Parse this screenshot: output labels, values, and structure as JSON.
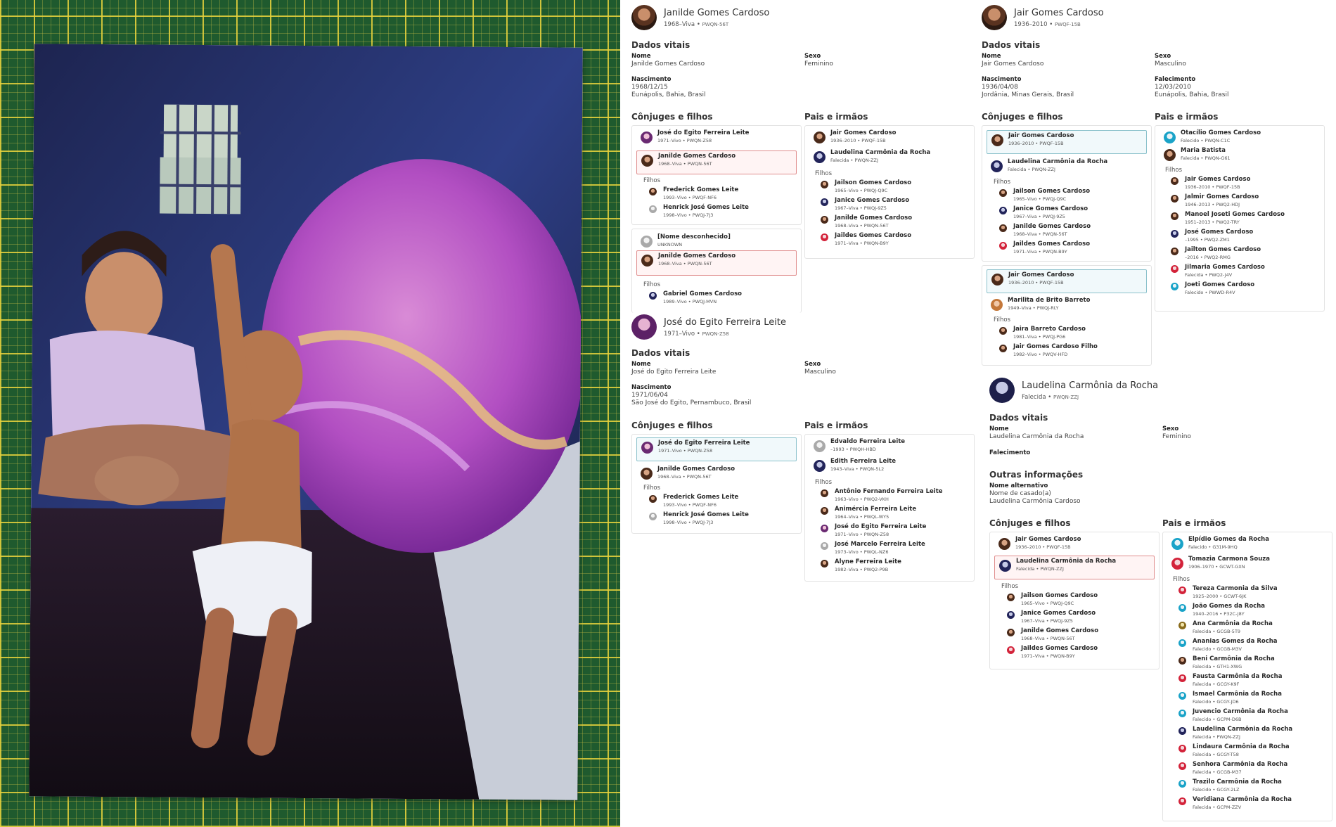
{
  "profiles": {
    "janilde": {
      "name": "Janilde Gomes Cardoso",
      "meta": "1968–Viva",
      "pid": "PWQN-56T",
      "vitals_title": "Dados vitais",
      "nome_label": "Nome",
      "nome_value": "Janilde Gomes Cardoso",
      "sexo_label": "Sexo",
      "sexo_value": "Feminino",
      "nasc_label": "Nascimento",
      "nasc_date": "1968/12/15",
      "nasc_place": "Eunápolis, Bahia, Brasil",
      "spouses_title": "Cônjuges e filhos",
      "parents_title": "Pais e irmãos",
      "family1": [
        {
          "name": "José do Egito Ferreira Leite",
          "meta": "1971–Vivo • PWQN-Z58"
        },
        {
          "name": "Janilde Gomes Cardoso",
          "meta": "1968–Viva • PWQN-56T"
        }
      ],
      "family1_filhos": "Filhos",
      "family1_children": [
        {
          "name": "Frederick Gomes Leite",
          "meta": "1993–Vivo • PWQF-NF6"
        },
        {
          "name": "Henrick José Gomes Leite",
          "meta": "1998–Vivo • PWQJ-7J3"
        }
      ],
      "family2": [
        {
          "name": "[Nome desconhecido]",
          "meta": "UNKNOWN"
        },
        {
          "name": "Janilde Gomes Cardoso",
          "meta": "1968–Viva • PWQN-56T"
        }
      ],
      "family2_filhos": "Filhos",
      "family2_children": [
        {
          "name": "Gabriel Gomes Cardoso",
          "meta": "1989–Vivo • PWQJ-MVN"
        }
      ],
      "parents": [
        {
          "name": "Jair Gomes Cardoso",
          "meta": "1936–2010 • PWQF-15B"
        },
        {
          "name": "Laudelina Carmônia da Rocha",
          "meta": "Falecida • PWQN-ZZJ"
        }
      ],
      "parents_filhos": "Filhos",
      "siblings": [
        {
          "name": "Jailson Gomes Cardoso",
          "meta": "1965–Vivo • PWQJ-Q9C"
        },
        {
          "name": "Janice Gomes Cardoso",
          "meta": "1967–Viva • PWQJ-9Z5"
        },
        {
          "name": "Janilde Gomes Cardoso",
          "meta": "1968–Viva • PWQN-56T"
        },
        {
          "name": "Jaildes Gomes Cardoso",
          "meta": "1971–Viva • PWQN-B9Y"
        }
      ]
    },
    "jair": {
      "name": "Jair Gomes Cardoso",
      "meta": "1936–2010",
      "pid": "PWQF-15B",
      "vitals_title": "Dados vitais",
      "nome_label": "Nome",
      "nome_value": "Jair Gomes Cardoso",
      "sexo_label": "Sexo",
      "sexo_value": "Masculino",
      "nasc_label": "Nascimento",
      "nasc_date": "1936/04/08",
      "nasc_place": "Jordânia, Minas Gerais, Brasil",
      "fal_label": "Falecimento",
      "fal_date": "12/03/2010",
      "fal_place": "Eunápolis, Bahia, Brasil",
      "spouses_title": "Cônjuges e filhos",
      "parents_title": "Pais e irmãos",
      "family1": [
        {
          "name": "Jair Gomes Cardoso",
          "meta": "1936–2010 • PWQF-15B"
        },
        {
          "name": "Laudelina Carmônia da Rocha",
          "meta": "Falecida • PWQN-ZZJ"
        }
      ],
      "family1_filhos": "Filhos",
      "family1_children": [
        {
          "name": "Jailson Gomes Cardoso",
          "meta": "1965–Vivo • PWQJ-Q9C"
        },
        {
          "name": "Janice Gomes Cardoso",
          "meta": "1967–Viva • PWQJ-9Z5"
        },
        {
          "name": "Janilde Gomes Cardoso",
          "meta": "1968–Viva • PWQN-56T"
        },
        {
          "name": "Jaildes Gomes Cardoso",
          "meta": "1971–Viva • PWQN-B9Y"
        }
      ],
      "family2": [
        {
          "name": "Jair Gomes Cardoso",
          "meta": "1936–2010 • PWQF-15B"
        },
        {
          "name": "Marilita de Brito Barreto",
          "meta": "1949–Viva • PWQJ-RLY"
        }
      ],
      "family2_filhos": "Filhos",
      "family2_children": [
        {
          "name": "Jaira Barreto Cardoso",
          "meta": "1981–Viva • PWQJ-PG6"
        },
        {
          "name": "Jair Gomes Cardoso Filho",
          "meta": "1982–Vivo • PWQV-HFD"
        }
      ],
      "parents": [
        {
          "name": "Otacílio Gomes Cardoso",
          "meta": "Falecido • PWQN-C1C"
        },
        {
          "name": "Maria Batista",
          "meta": "Falecida • PWQN-G61"
        }
      ],
      "parents_filhos": "Filhos",
      "siblings": [
        {
          "name": "Jair Gomes Cardoso",
          "meta": "1936–2010 • PWQF-15B"
        },
        {
          "name": "Jalmir Gomes Cardoso",
          "meta": "1946–2013 • PWQ2-HDJ"
        },
        {
          "name": "Manoel Joseti Gomes Cardoso",
          "meta": "1951–2013 • PWQ2-TRY"
        },
        {
          "name": "José Gomes Cardoso",
          "meta": "–1995 • PWQ2-ZM1"
        },
        {
          "name": "Jailton Gomes Cardoso",
          "meta": "–2016 • PWQ2-RMG"
        },
        {
          "name": "Jilmaria Gomes Cardoso",
          "meta": "Falecida • PWQ2-J4V"
        },
        {
          "name": "Joeti Gomes Cardoso",
          "meta": "Falecido • PWWD-R4V"
        }
      ]
    },
    "jose": {
      "name": "José do Egito Ferreira Leite",
      "meta": "1971–Vivo",
      "pid": "PWQN-Z58",
      "vitals_title": "Dados vitais",
      "nome_label": "Nome",
      "nome_value": "José do Egito Ferreira Leite",
      "sexo_label": "Sexo",
      "sexo_value": "Masculino",
      "nasc_label": "Nascimento",
      "nasc_date": "1971/06/04",
      "nasc_place": "São José do Egito, Pernambuco, Brasil",
      "spouses_title": "Cônjuges e filhos",
      "parents_title": "Pais e irmãos",
      "family1": [
        {
          "name": "José do Egito Ferreira Leite",
          "meta": "1971–Vivo • PWQN-Z58"
        },
        {
          "name": "Janilde Gomes Cardoso",
          "meta": "1968–Viva • PWQN-56T"
        }
      ],
      "family1_filhos": "Filhos",
      "family1_children": [
        {
          "name": "Frederick Gomes Leite",
          "meta": "1993–Vivo • PWQF-NF6"
        },
        {
          "name": "Henrick José Gomes Leite",
          "meta": "1998–Vivo • PWQJ-7J3"
        }
      ],
      "parents": [
        {
          "name": "Edvaldo Ferreira Leite",
          "meta": "–1993 • PWQH-HBD"
        },
        {
          "name": "Edith Ferreira Leite",
          "meta": "1943–Viva • PWQN-5L2"
        }
      ],
      "parents_filhos": "Filhos",
      "siblings": [
        {
          "name": "Antônio Fernando Ferreira Leite",
          "meta": "1963–Vivo • PWQ2-VKH"
        },
        {
          "name": "Animércia Ferreira Leite",
          "meta": "1964–Viva • PWQL-WY5"
        },
        {
          "name": "José do Egito Ferreira Leite",
          "meta": "1971–Vivo • PWQN-Z58"
        },
        {
          "name": "José Marcelo Ferreira Leite",
          "meta": "1973–Vivo • PWQL-NZ6"
        },
        {
          "name": "Alyne Ferreira Leite",
          "meta": "1982–Viva • PWQ2-P9B"
        }
      ]
    },
    "laudelina": {
      "name": "Laudelina Carmônia da Rocha",
      "meta": "Falecida",
      "pid": "PWQN-ZZJ",
      "vitals_title": "Dados vitais",
      "nome_label": "Nome",
      "nome_value": "Laudelina Carmônia da Rocha",
      "sexo_label": "Sexo",
      "sexo_value": "Feminino",
      "fal_label": "Falecimento",
      "other_title": "Outras informações",
      "alt_label": "Nome alternativo",
      "alt_type": "Nome de casado(a)",
      "alt_value": "Laudelina Carmônia Cardoso",
      "spouses_title": "Cônjuges e filhos",
      "parents_title": "Pais e irmãos",
      "family1": [
        {
          "name": "Jair Gomes Cardoso",
          "meta": "1936–2010 • PWQF-15B"
        },
        {
          "name": "Laudelina Carmônia da Rocha",
          "meta": "Falecida • PWQN-ZZJ"
        }
      ],
      "family1_filhos": "Filhos",
      "family1_children": [
        {
          "name": "Jailson Gomes Cardoso",
          "meta": "1965–Vivo • PWQJ-Q9C"
        },
        {
          "name": "Janice Gomes Cardoso",
          "meta": "1967–Viva • PWQJ-9Z5"
        },
        {
          "name": "Janilde Gomes Cardoso",
          "meta": "1968–Viva • PWQN-56T"
        },
        {
          "name": "Jaildes Gomes Cardoso",
          "meta": "1971–Viva • PWQN-B9Y"
        }
      ],
      "parents": [
        {
          "name": "Elpídio Gomes da Rocha",
          "meta": "Falecido • G31M-9HQ"
        },
        {
          "name": "Tomazia Carmona Souza",
          "meta": "1906–1970 • GCWT-GXN"
        }
      ],
      "parents_filhos": "Filhos",
      "siblings": [
        {
          "name": "Tereza Carmonia da Silva",
          "meta": "1925–2000 • GCWT-6JK"
        },
        {
          "name": "João Gomes da Rocha",
          "meta": "1940–2016 • P32C-J8Y"
        },
        {
          "name": "Ana Carmônia da Rocha",
          "meta": "Falecida • GCGB-5T9"
        },
        {
          "name": "Ananias Gomes da Rocha",
          "meta": "Falecido • GCGB-M3V"
        },
        {
          "name": "Beni Carmônia da Rocha",
          "meta": "Falecida • GTH1-XWG"
        },
        {
          "name": "Fausta Carmônia da Rocha",
          "meta": "Falecida • GCGY-K9F"
        },
        {
          "name": "Ismael Carmônia da Rocha",
          "meta": "Falecido • GCGY-JD6"
        },
        {
          "name": "Juvencio Carmônia da Rocha",
          "meta": "Falecido • GCPM-D6B"
        },
        {
          "name": "Laudelina Carmônia da Rocha",
          "meta": "Falecida • PWQN-ZZJ"
        },
        {
          "name": "Lindaura Carmônia da Rocha",
          "meta": "Falecida • GCGY-T58"
        },
        {
          "name": "Senhora Carmônia da Rocha",
          "meta": "Falecida • GCGB-M37"
        },
        {
          "name": "Trazilo Carmônia da Rocha",
          "meta": "Falecido • GCGY-2LZ"
        },
        {
          "name": "Veridiana Carmônia da Rocha",
          "meta": "Falecida • GCPM-ZZV"
        }
      ]
    }
  },
  "colors": {
    "selected_red": "#e08d8d",
    "selected_blue": "#8cc2cc",
    "mat_green": "#1f5a2e",
    "mat_grid": "#e6d23c"
  }
}
